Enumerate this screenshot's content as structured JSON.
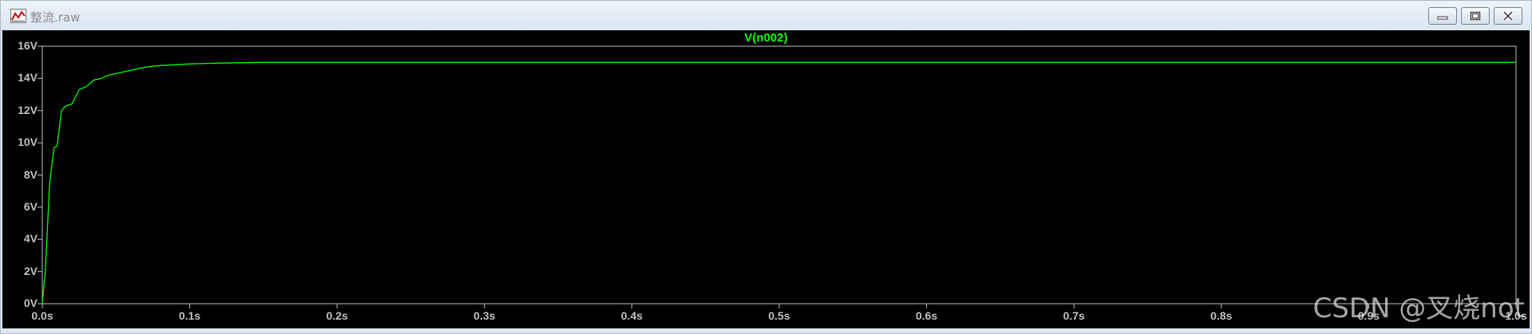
{
  "window": {
    "title": "整流.raw",
    "icon": "waveform-chart-icon",
    "controls": [
      "minimize-icon",
      "restore-icon",
      "close-icon"
    ]
  },
  "watermark": "CSDN @叉烧not",
  "colors": {
    "plot_background": "#000000",
    "trace": "#00ff00",
    "axis": "#c0c0c0",
    "frame": "#dde6f2"
  },
  "chart_data": {
    "type": "line",
    "title": "V(n002)",
    "xlabel": "",
    "ylabel": "",
    "xlim": [
      0,
      1.0
    ],
    "ylim": [
      0,
      16
    ],
    "x_ticks": [
      "0.0s",
      "0.1s",
      "0.2s",
      "0.3s",
      "0.4s",
      "0.5s",
      "0.6s",
      "0.7s",
      "0.8s",
      "0.9s",
      "1.0s"
    ],
    "y_ticks": [
      "0V",
      "2V",
      "4V",
      "6V",
      "8V",
      "10V",
      "12V",
      "14V",
      "16V"
    ],
    "grid": false,
    "series": [
      {
        "name": "V(n002)",
        "x": [
          0,
          0.002,
          0.005,
          0.008,
          0.01,
          0.013,
          0.016,
          0.02,
          0.025,
          0.03,
          0.035,
          0.04,
          0.045,
          0.05,
          0.06,
          0.07,
          0.08,
          0.09,
          0.1,
          0.12,
          0.15,
          0.2,
          0.3,
          0.4,
          0.5,
          0.6,
          0.7,
          0.8,
          0.9,
          1.0
        ],
        "values": [
          0,
          2.0,
          7.5,
          9.7,
          9.8,
          12.0,
          12.3,
          12.4,
          13.3,
          13.5,
          13.9,
          14.0,
          14.2,
          14.3,
          14.5,
          14.7,
          14.8,
          14.85,
          14.9,
          14.95,
          15.0,
          15.0,
          15.0,
          15.0,
          15.0,
          15.0,
          15.0,
          15.0,
          15.0,
          15.0
        ]
      }
    ]
  }
}
